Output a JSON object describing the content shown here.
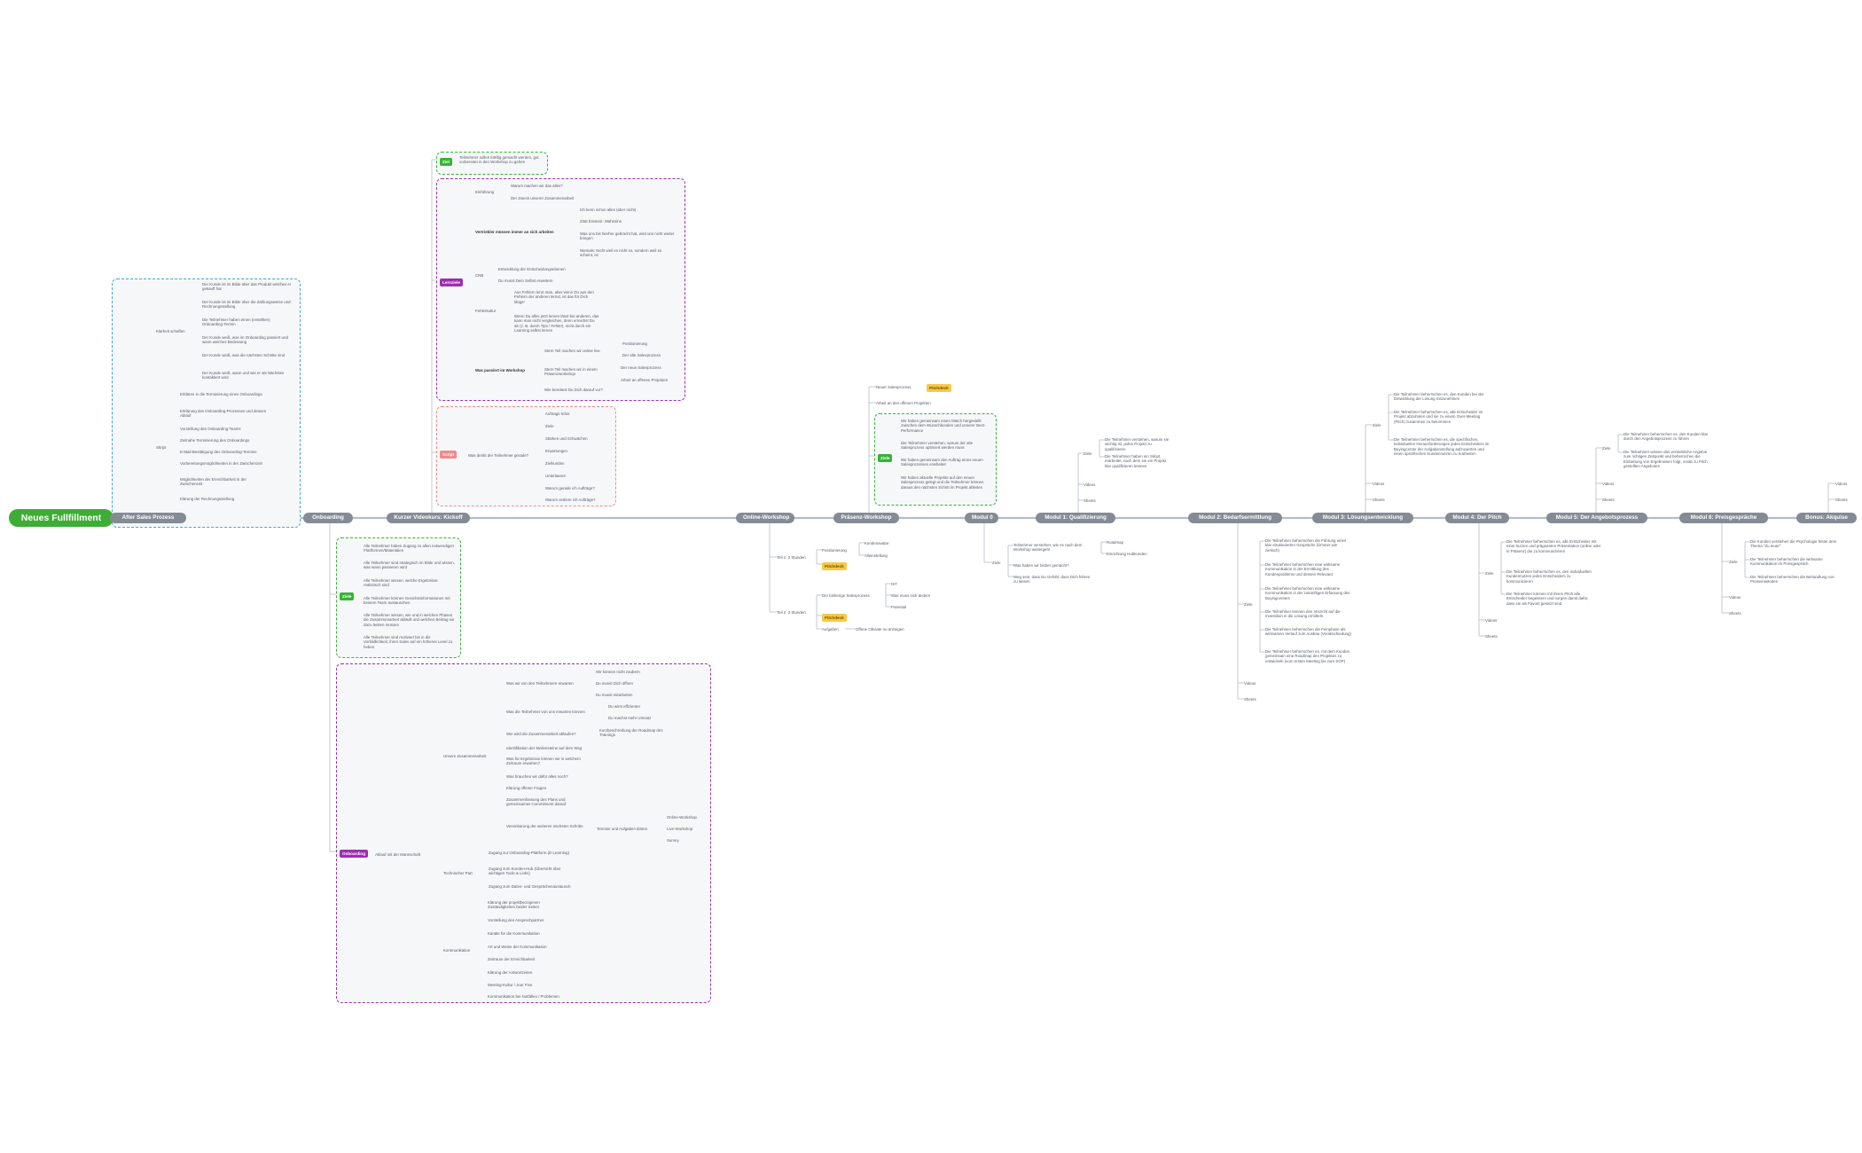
{
  "colors": {
    "root": "#3ead35",
    "stage_pill": "#858b95",
    "trunk": "#b5bcc6",
    "green": "#36b336",
    "purple": "#9c2fae",
    "red": "#f08a8a",
    "blue": "#3fa8dc",
    "yellow": "#f7c948"
  },
  "root": {
    "label": "Neues Fullfillment"
  },
  "stages": [
    {
      "label": "After Sales Prozess"
    },
    {
      "label": "Onboarding"
    },
    {
      "label": "Kurzer Videokurs: Kickoff"
    },
    {
      "label": "Online-Workshop"
    },
    {
      "label": "Präsenz-Workshop"
    },
    {
      "label": "Modul 0"
    },
    {
      "label": "Modul 1: Qualifizierung"
    },
    {
      "label": "Modul 2: Bedarfsermittlung"
    },
    {
      "label": "Modul 3: Lösungsentwicklung"
    },
    {
      "label": "Modul 4: Der Pitch"
    },
    {
      "label": "Modul 5: Der Angebotsprozess"
    },
    {
      "label": "Modul 6: Preisgespräche"
    },
    {
      "label": "Bonus: Akquise"
    }
  ],
  "tags": {
    "ziel": "Ziel",
    "ziele": "Ziele",
    "lernziele": "Lernziele",
    "onboarding": "Onboarding",
    "script": "Script",
    "pitchdeck": "Pitchdeck"
  },
  "after_sales": {
    "klarheit": "Klarheit schaffen",
    "klarheit_items": [
      "Der Kunde ist im Bilde über das Produkt welches er gekauft hat",
      "Der Kunde ist im Bilde über die Zahlungsweise und Rechnungsstellung",
      "Die Teilnehmer haben einen (erstellten) Onboarding-Termin",
      "Der Kunde weiß, was im Onboarding passiert und wann welches Bedeutung",
      "Der Kunde weiß, was die nächsten Schritte sind",
      "Der Kunde weiß, wann und wie er als Nächstes kontaktiert wird"
    ],
    "skript": "Skript",
    "skript_items": [
      "Erklären in die Terminierung eines Onboardings",
      "Erklärung des Onboarding-Prozesses und dessen Ablauf",
      "Vorstellung des Onboarding-Teams",
      "Zeitnahe Terminierung des Onboardings",
      "E-Mail-Bestätigung des Onboarding-Termins",
      "Vorbereitungsmöglichkeiten in der Zwischenzeit",
      "Möglichkeiten der Erreichbarkeit in der Zwischenzeit",
      "Klärung der Rechnungsstellung"
    ]
  },
  "kickoff": {
    "ziel_text": "Teilnehmer sollen kräftig gemacht werden, gut vorbereitet in den Workshop zu gehen",
    "lern": {
      "einf": "Einführung",
      "einf_items": [
        "Warum machen wir das alles?",
        "Der Zweck unserer Zusammenarbeit"
      ],
      "vertrieb": "Vertriebler müssen immer an sich arbeiten",
      "vertrieb_items": [
        "Ich kenn schon alles (aber nicht)",
        "Zitat Einstein: Wahnsinn",
        "Was uns bis hierher gebracht hat, wird uns nicht weiter bringen",
        "Niemals: Nicht weil es nicht so, sondern weil es scheint, ist"
      ],
      "cnb": "CNB",
      "cnb_items": [
        "Entwicklung der Entscheidungsebenen",
        "Du musst Dein Selbst erweitern"
      ],
      "fehler": "Fehlerkultur",
      "fehler_items": [
        "Aus Fehlern lernt man, aber wenn Du aus den Fehlern der anderen lernst, ist das für Dich klüger",
        "Wenn Du alles jetzt lernen lässt bei anderen, das kann man nicht vergleichen, denn erreichst Du ab (z. B. durch Tips / Fehler), nicht durch ein Learning selbst lernen"
      ],
      "was": "Was passiert im Workshop",
      "was_items": [
        "Stern Teil machen wir online live",
        "Stern Teil machen wir in einem Präsenzworkshop",
        "Wie bereitest Du Dich darauf vor?"
      ],
      "online_sub": [
        "Positionierung",
        "Der alte Salesprozess"
      ],
      "praesenz_sub": [
        "Der neue Salesprozess",
        "Arbeit an offenen Projekten"
      ]
    },
    "script_q": "Was denkt der Teilnehmer gerade?",
    "script_items": [
      "Auftrags-Infos",
      "Ziele",
      "Stärken und Schwächen",
      "Erwartungen",
      "Zielkunden",
      "Unterlassen",
      "Warum gerade ich Aufträge?",
      "Warum verliere ich Aufträge?"
    ]
  },
  "onboarding": {
    "ziele_items": [
      "Alle Teilnehmer haben Zugang zu allen notwendigen Plattformen/Materialien",
      "Alle Teilnehmer sind strategisch im Bilde und wissen, was wann passieren wird",
      "Alle Teilnehmer wissen, welche Ergebnisse realistisch sind",
      "Alle Teilnehmer können Gesichtsinformationen mit beinem Team austauschen",
      "Alle Teilnehmer wissen, wie und in welchen Phasen die Zusammenarbeit abläuft und welchen Beitrag sie dazu leisten müssen",
      "Alle Teilnehmer sind motiviert bis in die Vorbildlichkeit, ihren Sales auf ein höheres Level zu heben"
    ],
    "ablauf": "Ablauf mit der Mannschaft",
    "zusammen": "Unsere Zusammenarbeit",
    "erwartet": "Was wir von den Teilnehmern erwarten",
    "erwartet_items": [
      "Wir können nicht zaubern",
      "Du musst Dich öffnen",
      "Du musst mitarbeiten"
    ],
    "erwarten_ttn": "Was die Teilnehmer von uns erwarten können",
    "erwarten_ttn_items": [
      "Du wirst effizienter",
      "Du machst mehr Umsatz"
    ],
    "ablauf_zus": "Wie wird die Zusammenarbeit ablaufen?",
    "roadmap": "Kurzbeschreibung der Roadmap des Trainings",
    "meilen": "Identifikation der Meilensteine auf dem Weg",
    "ergebnisse": "Was für Ergebnisse können wir in welchem Zeitraum erwarten?",
    "brauchen": "Was brauchen wir dafür alles noch?",
    "klaerung": "Klärung offener Fragen",
    "zusammenfass": "Zusammenfassung des Plans und gemeinsames Commitment darauf",
    "vereinbarung": "Vereinbarung der weiteren nächsten Schritte",
    "termine": "Termine und Aufgaben klären",
    "termine_items": [
      "Online-Workshop",
      "Live-Workshop",
      "Survey"
    ],
    "tech": "Technischer Part",
    "tech_items": [
      "Zugang zur Onboarding-Plattform (E-Learning)",
      "Zugang zum Kunden-Hub (Übersicht über wichtigen Tools & Links)",
      "Zugang zum Daten- und Gesprächenaustausch"
    ],
    "komm": "Kommunikation",
    "komm_items": [
      "Klärung der projektbezogenen Zuständigkeiten beider Seiten",
      "Vorstellung des Ansprechpartner",
      "Kanäle für die Kommunikation",
      "Art und Weise der Kommunikation",
      "Zeitraum der Erreichbarkeit",
      "Klärung der Antwortzeiten",
      "Meeting-Kultur / Jour Fixe",
      "Kommunikation bei Notfällen / Problemen"
    ]
  },
  "online_ws": {
    "teil1": "Teil 1: 2 Stunden",
    "teil1_a": "Positionierung",
    "teil1_a_items": [
      "Kundenavatar",
      "Alleinstellung"
    ],
    "teil2": "Teil 2: 2 Stunden",
    "teil2_a": "Der bisherige Salesprozess",
    "teil2_a_items": [
      "IST",
      "Was muss sich ändern",
      "Potential"
    ],
    "aufgaben": "Aufgaben",
    "aufgaben_item": "Offene Obviate nu anzeigen"
  },
  "praesenz": {
    "neuer": "Neuer Salesprozess",
    "arbeit": "Arbeit an den offenen Projekten",
    "ziele_items": [
      "Wir haben gemeinsam einen Match hergestellt zwischen dem Wunschkunden und unserer Best-Performance",
      "Die Teilnehmer verstehen, warum der alte Salesprozess optimiert werden muss",
      "Wir haben gemeinsam den Auftrag eines neuen Salesprozesses erarbeitet",
      "Wir haben aktuelle Projekte auf den neuen Salesprozess gelegt und die Teilnehmer können daraus den nächsten Schritt im Projekt ableiten"
    ]
  },
  "modul0": {
    "ziele_items": [
      "Teilnehmer verstehen, wie es nach dem Workshop weitergeht",
      "Was haben wir bisher gemacht?",
      "Weg sein, dass Du Gefühl, dass Dich führen zu lassen"
    ],
    "sub": [
      "Roadmap",
      "Einrichtung Hubkunden"
    ],
    "rest": "Weg sein, dass Du Gefühl, dass über den Händler greifen muss"
  },
  "modul1": {
    "ziele_items": [
      "Die Teilnehmer verstehen, warum sie wichtig ist, jedes Projekt zu qualifizieren",
      "Die Teilnehmer haben ein Skript erarbeitet, nach dem sie ein Projekt klar qualifizieren können"
    ],
    "videos": "Videos",
    "sheets": "Sheets"
  },
  "modul2": {
    "ziele_items": [
      "Die Teilnehmer beherrschen die Führung eines klar strukturierten Gesprächs (Ümmer wie zielisch)",
      "Die Teilnehmer beherrschen eine wirksame Kommunikation in der Ermittlung des Kundenproblems und dessen Relevanz",
      "Die Teilnehmer beherrschen eine wirksame Kommunikation in der zukünftigen Erfassung des Buyingcenters",
      "Die Teilnehmer kennen den Verzicht auf die Investition in die Lösung ermitteln",
      "Die Teilnehmer beherrschen die Feinphase als wirksamen Verlauf zum Ausbau (Verabschiedung)",
      "Die Teilnehmer beherrschen es, mit dem Kunden gemeinsam eine Roadmap des Projektes zu entwickeln (vom ersten Meeting bis zum SOP)"
    ],
    "videos": "Videos",
    "sheets": "Sheets"
  },
  "modul3": {
    "ziele_items": [
      "Die Teilnehmer beherrschen es, den Kunden bei der Entwicklung der Lösung mitzunehmen",
      "Die Teilnehmer beherrschen es, alle Entscheider im Projekt abzuholen und sie zu einem Over-Meeting (Pitch) zusammen zu bekommen",
      "Die Teilnehmer beherrschen es, die spezifischen, individuellen Herausforderungen jedes Entscheiders im Buyingcenter der Aufgabenstellung aufzuwerten und einen spezifischen Kundennutzen zu erarbeiten"
    ],
    "videos": "Videos",
    "sheets": "Sheets"
  },
  "modul4": {
    "ziele_items": [
      "Die Teilnehmer beherrschen es, alle Entscheider mit einer kurzen und prägnanten Präsentation (online oder in Präsenz) die zu kommunizieren",
      "Die Teilnehmer beherrschen es, den individuellen Kundennutzen jedes Entscheiders zu kommunizieren",
      "Die Teilnehmer können mit ihrem Pitch alle Entscheider begeistern und sorgen damit dafür, dass sie als Favorit gesetzt sind"
    ],
    "videos": "Videos",
    "sheets": "Sheets"
  },
  "modul5": {
    "ziele_items": [
      "Die Teilnehmer beherrschen es, den Kunden klar durch den Angebotsprozess zu führen",
      "Die Teilnehmer wissen das vertriebliche Angebot zum richtigen Zeitpunkt und beherrschen die Einbettung von Ergebnissen folgt, vorab zu Pitch gestellten Angebotes"
    ],
    "videos": "Videos",
    "sheets": "Sheets"
  },
  "modul6": {
    "ziele_items": [
      "Die Kunden verstehen die Psychologie hinter dem Thema \"Zu teuer\"",
      "Die Teilnehmer beherrschen die wirksame Kommunikation im Preisgespräch",
      "Die Teilnehmer beherrschen die Behandlung von Preiseinwänden"
    ],
    "videos": "Videos",
    "sheets": "Sheets"
  },
  "bonus": {
    "videos": "Videos",
    "sheets": "Sheets"
  }
}
